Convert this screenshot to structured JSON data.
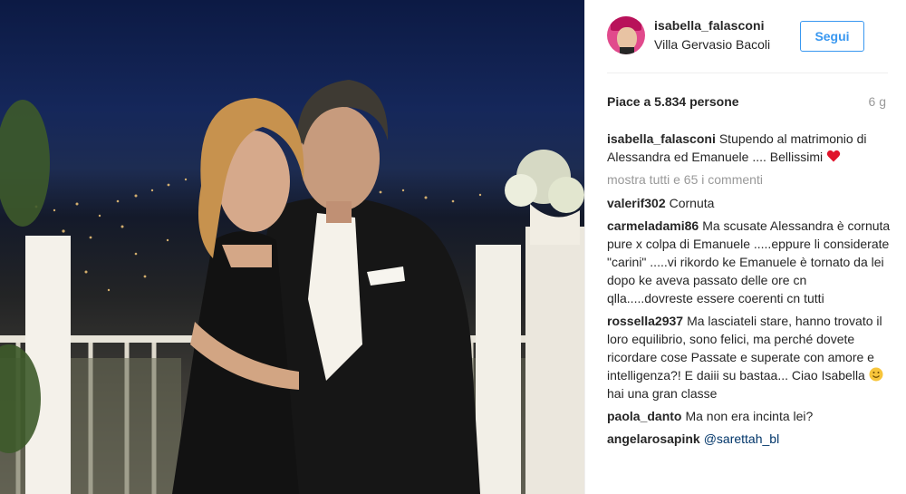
{
  "post": {
    "username": "isabella_falasconi",
    "location": "Villa Gervasio Bacoli",
    "follow_label": "Segui",
    "likes": "Piace a 5.834 persone",
    "age": "6 g"
  },
  "caption": {
    "username": "isabella_falasconi",
    "text": "Stupendo al matrimonio di Alessandra ed Emanuele .... Bellissimi",
    "emoji": "heart-emoji"
  },
  "load_more": "mostra tutti e 65 i commenti",
  "comments": [
    {
      "username": "valerif302",
      "text": "Cornuta"
    },
    {
      "username": "carmeladami86",
      "text": "Ma scusate Alessandra è cornuta pure x colpa di Emanuele .....eppure li considerate \"carini\" .....vi rikordo ke Emanuele è tornato da lei dopo ke aveva passato delle ore cn qlla.....dovreste essere coerenti cn tutti"
    },
    {
      "username": "rossella2937",
      "text_before": "Ma lasciateli stare, hanno trovato il loro equilibrio, sono felici, ma perché dovete ricordare cose Passate e superate con amore e intelligenza?! E daiii su bastaa... Ciao Isabella",
      "text_after": "hai una gran classe",
      "emoji": "smile-emoji"
    },
    {
      "username": "paola_danto",
      "text": "Ma non era incinta lei?"
    },
    {
      "username": "angelarosapink",
      "mention": "@sarettah_bl"
    }
  ],
  "colors": {
    "accent": "#3897f0",
    "text": "#262626",
    "muted": "#999999",
    "mention": "#003569"
  }
}
